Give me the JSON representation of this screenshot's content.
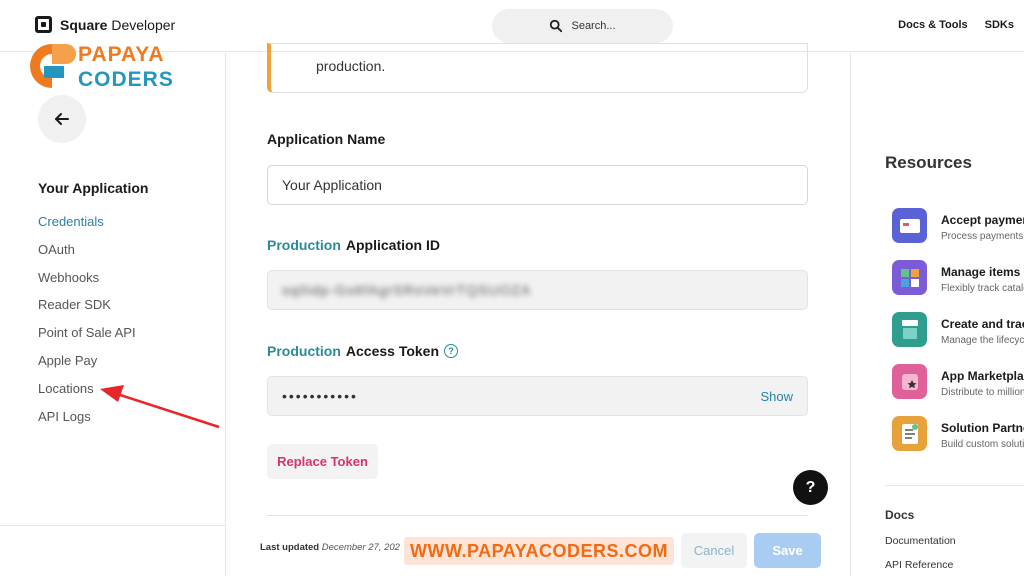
{
  "header": {
    "brand_bold": "Square",
    "brand_rest": "Developer",
    "search_placeholder": "Search...",
    "nav": [
      "Docs & Tools",
      "SDKs"
    ]
  },
  "watermark": {
    "logo_line1": "PAPAYA",
    "logo_line2": "CODERS",
    "url": "WWW.PAPAYACODERS.COM"
  },
  "sidebar": {
    "title": "Your Application",
    "items": [
      {
        "label": "Credentials",
        "active": true
      },
      {
        "label": "OAuth"
      },
      {
        "label": "Webhooks"
      },
      {
        "label": "Reader SDK"
      },
      {
        "label": "Point of Sale API"
      },
      {
        "label": "Apple Pay"
      },
      {
        "label": "Locations"
      },
      {
        "label": "API Logs"
      }
    ]
  },
  "main": {
    "notice_text": "production.",
    "app_name_label": "Application Name",
    "app_name_value": "Your Application",
    "app_id_label_hl": "Production",
    "app_id_label_rest": "Application ID",
    "app_id_value": "sq0idp-Gs6fAgrSRsVeVrTQSUOZA",
    "token_label_hl": "Production",
    "token_label_rest": "Access Token",
    "token_value": "•••••••••••",
    "show_label": "Show",
    "replace_label": "Replace Token",
    "help_label": "?",
    "last_updated_label": "Last updated",
    "last_updated_date": "December 27, 202",
    "cancel_label": "Cancel",
    "save_label": "Save"
  },
  "resources": {
    "title": "Resources",
    "items": [
      {
        "name": "Accept payments",
        "desc": "Process payments",
        "color": "#5a63d6",
        "icon": "card-icon"
      },
      {
        "name": "Manage items",
        "desc": "Flexibly track catalog",
        "color": "#7b5bd6",
        "icon": "grid-icon"
      },
      {
        "name": "Create and track",
        "desc": "Manage the lifecycle",
        "color": "#2f9e8f",
        "icon": "stack-icon"
      },
      {
        "name": "App Marketplace",
        "desc": "Distribute to millions",
        "color": "#e0609a",
        "icon": "star-icon"
      },
      {
        "name": "Solution Partners",
        "desc": "Build custom solutions",
        "color": "#e8a23c",
        "icon": "doc-icon"
      }
    ],
    "docs_title": "Docs",
    "docs_links": [
      "Documentation",
      "API Reference"
    ]
  }
}
